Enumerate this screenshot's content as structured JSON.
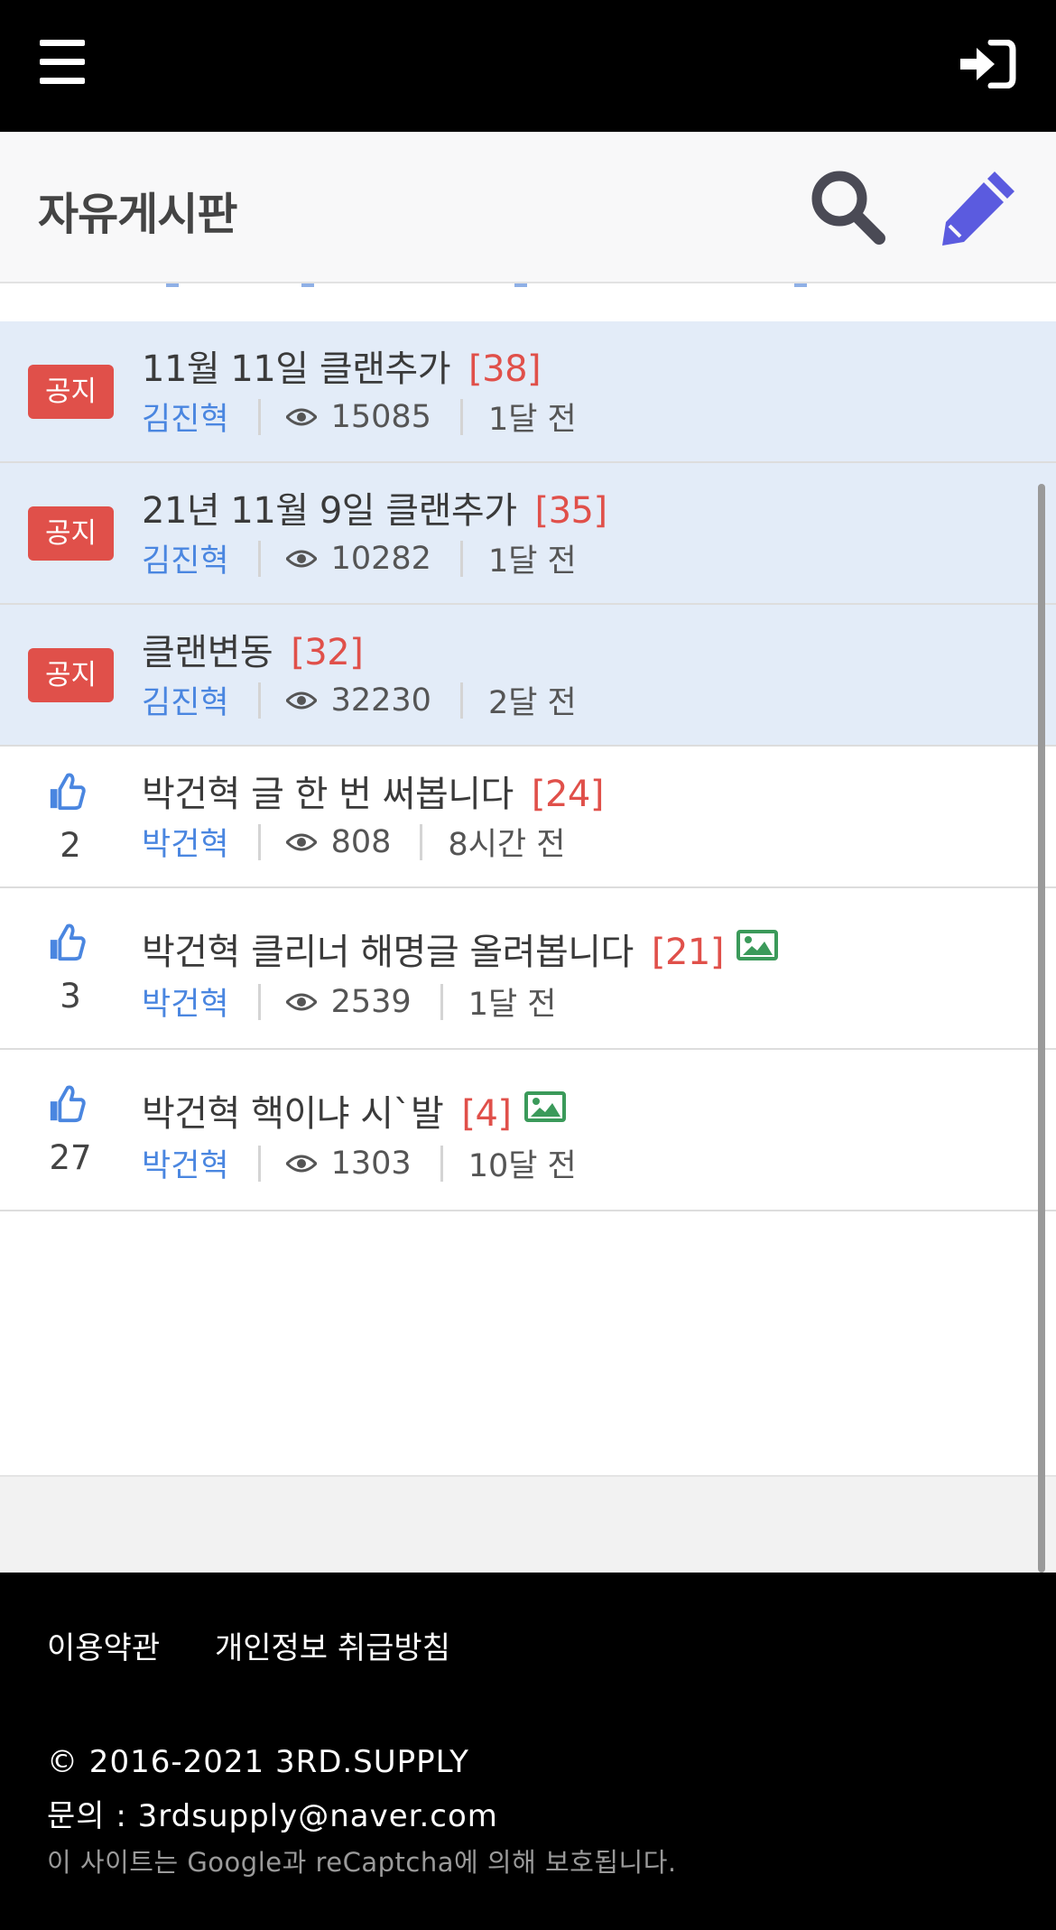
{
  "colors": {
    "notice_bg": "#e3ecf8",
    "badge": "#e0504a",
    "author": "#4a86e0",
    "comment_count": "#e0504a",
    "accent_write": "#5b5bdf",
    "image_icon": "#3b9a5a"
  },
  "topbar": {
    "menu_icon": "hamburger-menu-icon",
    "login_icon": "sign-in-icon"
  },
  "board": {
    "title": "자유게시판",
    "search_icon": "search-icon",
    "write_icon": "pencil-icon"
  },
  "posts": [
    {
      "notice": true,
      "badge": "공지",
      "title": "11월 11일 클랜추가",
      "comments": "[38]",
      "author": "김진혁",
      "views": "15085",
      "time": "1달 전"
    },
    {
      "notice": true,
      "badge": "공지",
      "title": "21년 11월 9일 클랜추가",
      "comments": "[35]",
      "author": "김진혁",
      "views": "10282",
      "time": "1달 전"
    },
    {
      "notice": true,
      "badge": "공지",
      "title": "클랜변동",
      "comments": "[32]",
      "author": "김진혁",
      "views": "32230",
      "time": "2달 전"
    },
    {
      "notice": false,
      "likes": "2",
      "title": "박건혁 글 한 번 써봅니다",
      "comments": "[24]",
      "has_image": false,
      "author": "박건혁",
      "views": "808",
      "time": "8시간 전"
    },
    {
      "notice": false,
      "likes": "3",
      "title": "박건혁 클리너 해명글 올려봅니다",
      "comments": "[21]",
      "has_image": true,
      "author": "박건혁",
      "views": "2539",
      "time": "1달 전"
    },
    {
      "notice": false,
      "likes": "27",
      "title": "박건혁 핵이냐 시`발",
      "comments": "[4]",
      "has_image": true,
      "author": "박건혁",
      "views": "1303",
      "time": "10달 전"
    }
  ],
  "footer": {
    "terms": "이용약관",
    "privacy": "개인정보 취급방침",
    "copyright": "© 2016-2021 3RD.SUPPLY",
    "contact": "문의 : 3rdsupply@naver.com",
    "recaptcha": "이 사이트는 Google과 reCaptcha에 의해 보호됩니다."
  }
}
